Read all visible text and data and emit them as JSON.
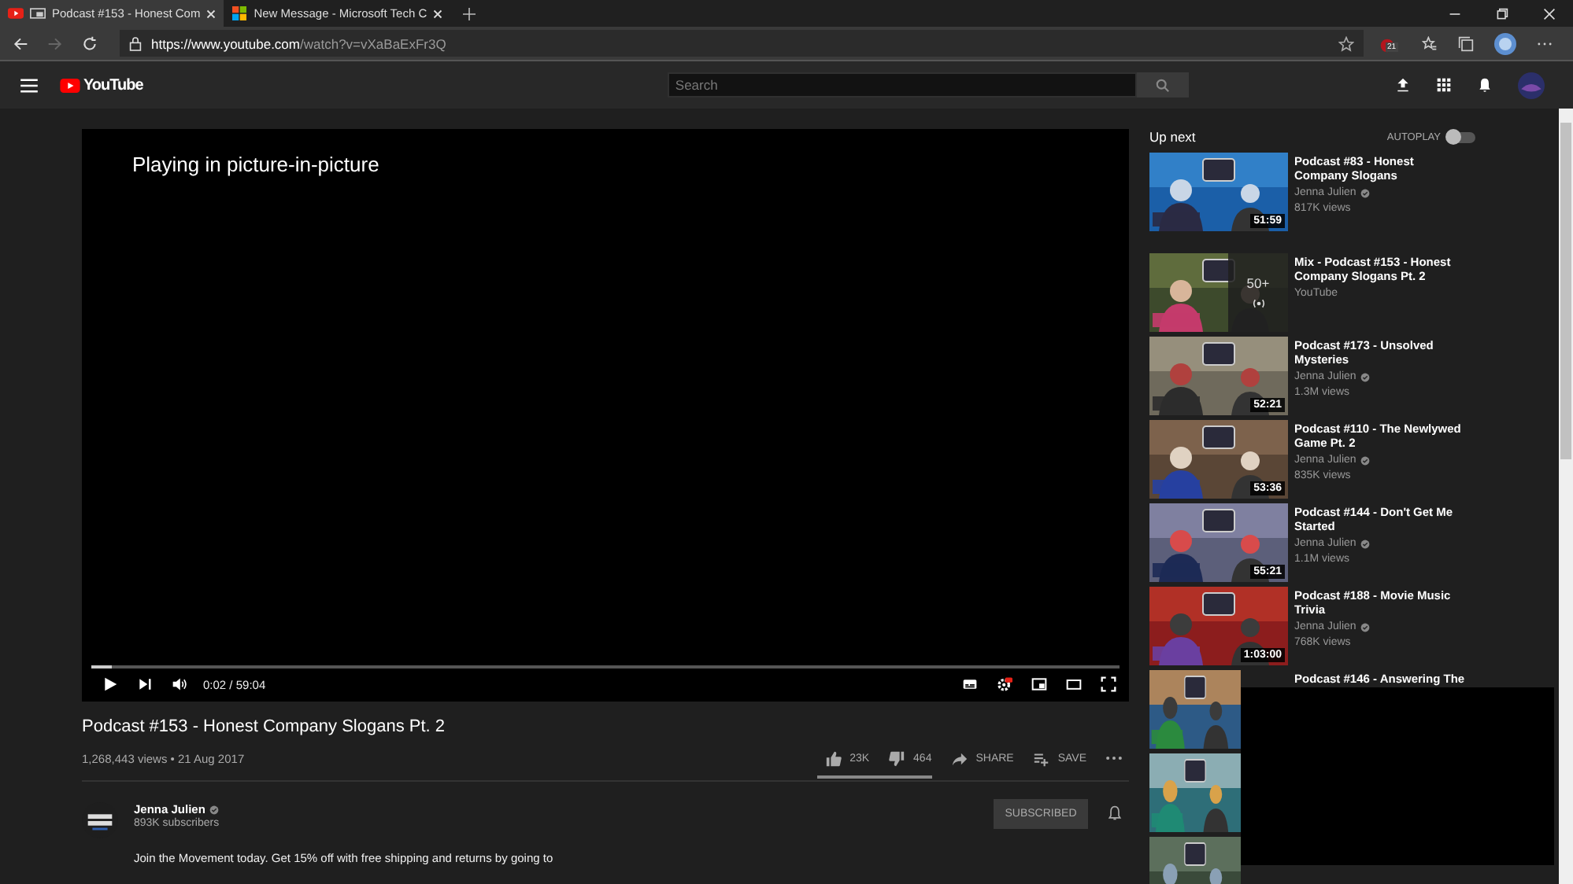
{
  "browser": {
    "tabs": [
      {
        "title": "Podcast #153 - Honest Com",
        "selected": true,
        "kind": "youtube"
      },
      {
        "title": "New Message - Microsoft Tech C",
        "selected": false,
        "kind": "microsoft"
      }
    ],
    "address": {
      "host": "https://www.youtube.com",
      "path": "/watch?v=vXaBaExFr3Q"
    },
    "extension_badge": "21"
  },
  "header": {
    "logo": "YouTube",
    "search": {
      "placeholder": "Search"
    }
  },
  "player": {
    "message": "Playing in picture-in-picture",
    "level": 0.02,
    "time": "0:02 / 59:04"
  },
  "video": {
    "title": "Podcast #153 - Honest Company Slogans Pt. 2",
    "meta": "1,268,443 views • 21 Aug 2017",
    "likes": "23K",
    "dislikes": "464",
    "share": "SHARE",
    "save": "SAVE"
  },
  "channel": {
    "name": "Jenna Julien",
    "subscribers": "893K subscribers",
    "subscribe": "SUBSCRIBED"
  },
  "description": "Join the Movement today. Get 15% off with free shipping and returns by going to",
  "sidebar": {
    "heading": "Up next",
    "autoplay": {
      "label": "AUTOPLAY",
      "on": false
    },
    "items": [
      {
        "kind": "video",
        "title": "Podcast #83 - Honest Company Slogans",
        "channel": "Jenna Julien",
        "views": "817K views",
        "duration": "51:59"
      },
      {
        "kind": "mix",
        "title": "Mix - Podcast #153 - Honest Company Slogans Pt. 2",
        "channel": "YouTube",
        "count": "50+"
      },
      {
        "kind": "video",
        "title": "Podcast #173 - Unsolved Mysteries",
        "channel": "Jenna Julien",
        "views": "1.3M views",
        "duration": "52:21"
      },
      {
        "kind": "video",
        "title": "Podcast #110 - The Newlywed Game Pt. 2",
        "channel": "Jenna Julien",
        "views": "835K views",
        "duration": "53:36"
      },
      {
        "kind": "video",
        "title": "Podcast #144 - Don't Get Me Started",
        "channel": "Jenna Julien",
        "views": "1.1M views",
        "duration": "55:21"
      },
      {
        "kind": "video",
        "title": "Podcast #188 - Movie Music Trivia",
        "channel": "Jenna Julien",
        "views": "768K views",
        "duration": "1:03:00"
      },
      {
        "kind": "covered",
        "title": "Podcast #146 - Answering The"
      },
      {
        "kind": "covered"
      },
      {
        "kind": "covered"
      }
    ]
  }
}
